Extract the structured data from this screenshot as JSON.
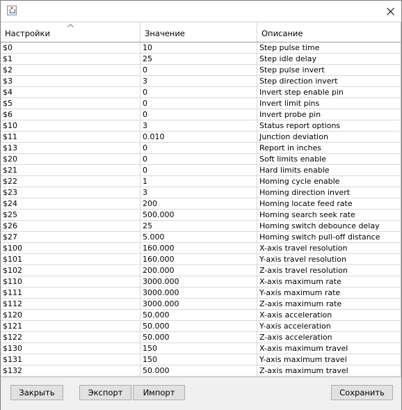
{
  "window": {
    "title": ""
  },
  "table": {
    "columns": [
      "Настройки",
      "Значение",
      "Описание"
    ],
    "sort_indicator": "ascending",
    "rows": [
      [
        "$0",
        "10",
        "Step pulse time"
      ],
      [
        "$1",
        "25",
        "Step idle delay"
      ],
      [
        "$2",
        "0",
        "Step pulse invert"
      ],
      [
        "$3",
        "3",
        "Step direction invert"
      ],
      [
        "$4",
        "0",
        "Invert step enable pin"
      ],
      [
        "$5",
        "0",
        "Invert limit pins"
      ],
      [
        "$6",
        "0",
        "Invert probe pin"
      ],
      [
        "$10",
        "3",
        "Status report options"
      ],
      [
        "$11",
        "0.010",
        "Junction deviation"
      ],
      [
        "$13",
        "0",
        "Report in inches"
      ],
      [
        "$20",
        "0",
        "Soft limits enable"
      ],
      [
        "$21",
        "0",
        "Hard limits enable"
      ],
      [
        "$22",
        "1",
        "Homing cycle enable"
      ],
      [
        "$23",
        "3",
        "Homing direction invert"
      ],
      [
        "$24",
        "200",
        "Homing locate feed rate"
      ],
      [
        "$25",
        "500.000",
        "Homing search seek rate"
      ],
      [
        "$26",
        "25",
        "Homing switch debounce delay"
      ],
      [
        "$27",
        "5.000",
        "Homing switch pull-off distance"
      ],
      [
        "$100",
        "160.000",
        "X-axis travel resolution"
      ],
      [
        "$101",
        "160.000",
        "Y-axis travel resolution"
      ],
      [
        "$102",
        "200.000",
        "Z-axis travel resolution"
      ],
      [
        "$110",
        "3000.000",
        "X-axis maximum rate"
      ],
      [
        "$111",
        "3000.000",
        "Y-axis maximum rate"
      ],
      [
        "$112",
        "3000.000",
        "Z-axis maximum rate"
      ],
      [
        "$120",
        "50.000",
        "X-axis acceleration"
      ],
      [
        "$121",
        "50.000",
        "Y-axis acceleration"
      ],
      [
        "$122",
        "50.000",
        "Z-axis acceleration"
      ],
      [
        "$130",
        "150",
        "X-axis maximum travel"
      ],
      [
        "$131",
        "150",
        "Y-axis maximum travel"
      ],
      [
        "$132",
        "50.000",
        "Z-axis maximum travel"
      ]
    ]
  },
  "buttons": {
    "close": "Закрыть",
    "export": "Экспорт",
    "import": "Импорт",
    "save": "Сохранить"
  },
  "icons": {
    "app": "java-cup-icon",
    "close": "close-icon",
    "sort": "sort-ascending-icon"
  },
  "colors": {
    "window_bg": "#ffffff",
    "panel_bg": "#f0f0f0",
    "button_bg": "#e1e1e1",
    "grid_line": "#d8d8d8"
  }
}
